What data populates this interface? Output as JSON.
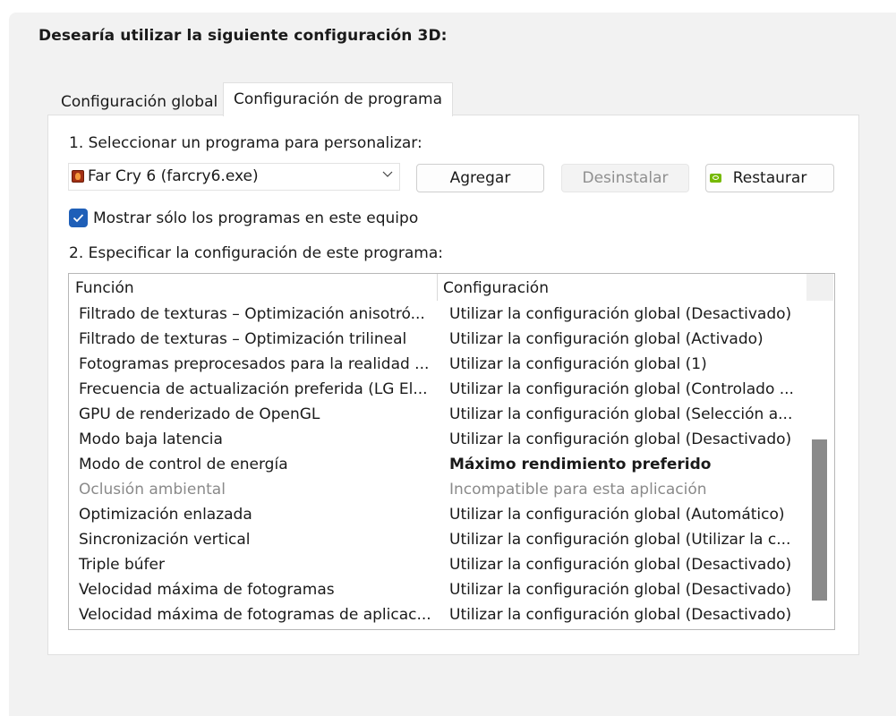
{
  "heading": "Desearía utilizar la siguiente configuración 3D:",
  "tabs": [
    {
      "label": "Configuración global",
      "active": false
    },
    {
      "label": "Configuración de programa",
      "active": true
    }
  ],
  "program_section": {
    "step1_label": "1. Seleccionar un programa para personalizar:",
    "selected_program": "Far Cry 6 (farcry6.exe)",
    "buttons": {
      "add": "Agregar",
      "uninstall": "Desinstalar",
      "restore": "Restaurar"
    },
    "show_only_checkbox": {
      "label": "Mostrar sólo los programas en este equipo",
      "checked": true
    },
    "step2_label": "2. Especificar la configuración de este programa:"
  },
  "settings_table": {
    "columns": [
      "Función",
      "Configuración"
    ],
    "rows": [
      {
        "function": "Filtrado de texturas – Optimización anisotró...",
        "setting": "Utilizar la configuración global (Desactivado)"
      },
      {
        "function": "Filtrado de texturas – Optimización trilineal",
        "setting": "Utilizar la configuración global (Activado)"
      },
      {
        "function": "Fotogramas preprocesados para la realidad ...",
        "setting": "Utilizar la configuración global (1)"
      },
      {
        "function": "Frecuencia de actualización preferida (LG El...",
        "setting": "Utilizar la configuración global (Controlado ..."
      },
      {
        "function": "GPU de renderizado de OpenGL",
        "setting": "Utilizar la configuración global (Selección a..."
      },
      {
        "function": "Modo baja latencia",
        "setting": "Utilizar la configuración global (Desactivado)"
      },
      {
        "function": "Modo de control de energía",
        "setting": "Máximo rendimiento preferido"
      },
      {
        "function": "Oclusión ambiental",
        "setting": "Incompatible para esta aplicación"
      },
      {
        "function": "Optimización enlazada",
        "setting": "Utilizar la configuración global (Automático)"
      },
      {
        "function": "Sincronización vertical",
        "setting": "Utilizar la configuración global (Utilizar la c..."
      },
      {
        "function": "Triple búfer",
        "setting": "Utilizar la configuración global (Desactivado)"
      },
      {
        "function": "Velocidad máxima de fotogramas",
        "setting": "Utilizar la configuración global (Desactivado)"
      },
      {
        "function": "Velocidad máxima de fotogramas de aplicac...",
        "setting": "Utilizar la configuración global (Desactivado)"
      }
    ]
  },
  "colors": {
    "checkbox_accent": "#1f5fb8",
    "nvidia_green": "#76b900",
    "disabled_text": "#8a8a8a"
  },
  "icons": {
    "program": "far-cry-6-icon",
    "dropdown": "chevron-down-icon",
    "restore": "nvidia-icon",
    "checkbox": "checkmark-icon"
  }
}
